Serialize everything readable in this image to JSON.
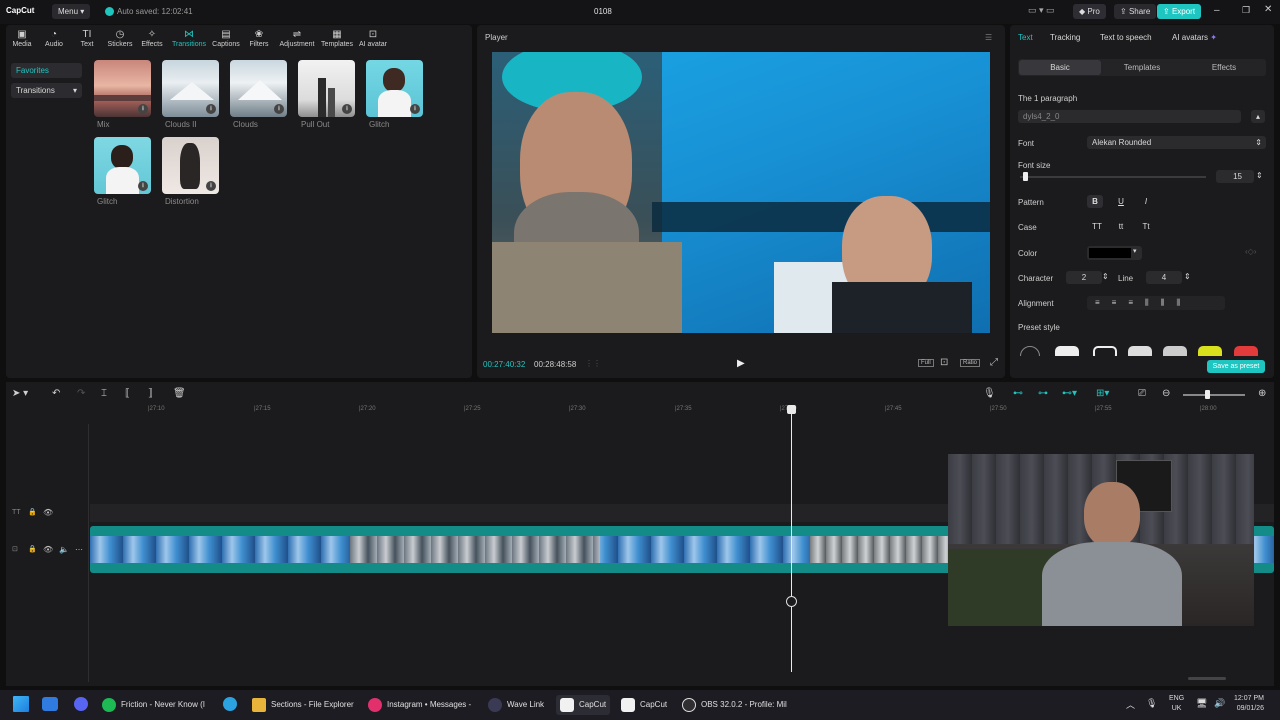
{
  "titlebar": {
    "logo": "CapCut",
    "menu": "Menu",
    "autosave": "Auto saved: 12:02:41",
    "project": "0108",
    "pro": "Pro",
    "share": "Share",
    "export": "Export"
  },
  "toolbar": {
    "items": [
      "Media",
      "Audio",
      "Text",
      "Stickers",
      "Effects",
      "Transitions",
      "Captions",
      "Filters",
      "Adjustment",
      "Templates",
      "AI avatar"
    ]
  },
  "sidebar": {
    "favorites": "Favorites",
    "transitions": "Transitions"
  },
  "transitions": [
    {
      "label": "Mix"
    },
    {
      "label": "Clouds II"
    },
    {
      "label": "Clouds"
    },
    {
      "label": "Pull Out"
    },
    {
      "label": "Glitch"
    },
    {
      "label": "Glitch"
    },
    {
      "label": "Distortion"
    }
  ],
  "player": {
    "title": "Player",
    "current": "00:27:40:32",
    "total": "00:28:48:58",
    "full": "Full",
    "ratio": "Ratio"
  },
  "props": {
    "tabs": [
      "Text",
      "Tracking",
      "Text to speech",
      "AI avatars"
    ],
    "subtabs": [
      "Basic",
      "Templates",
      "Effects"
    ],
    "paragraph": "The 1 paragraph",
    "text_value": "dyls4_2_0",
    "font_label": "Font",
    "font_value": "Alekan Rounded",
    "size_label": "Font size",
    "size_value": "15",
    "pattern_label": "Pattern",
    "case_label": "Case",
    "color_label": "Color",
    "character_label": "Character",
    "character_value": "2",
    "line_label": "Line",
    "line_value": "4",
    "alignment_label": "Alignment",
    "preset_label": "Preset style",
    "save_preset": "Save as preset",
    "bold": "B",
    "underline": "U",
    "italic": "I",
    "case_opts": [
      "TT",
      "tt",
      "Tt"
    ]
  },
  "timeline": {
    "ruler": [
      "|27:10",
      "|27:15",
      "|27:20",
      "|27:25",
      "|27:30",
      "|27:35",
      "|27:40",
      "|27:45",
      "|27:50",
      "|27:55",
      "|28:00"
    ],
    "text_track": "TT"
  },
  "taskbar": {
    "items": [
      "Friction - Never Know (I",
      "Sections - File Explorer",
      "Instagram • Messages -",
      "Wave Link",
      "CapCut",
      "CapCut",
      "OBS 32.0.2 - Profile: Mil"
    ],
    "lang": "ENG",
    "region": "UK",
    "time": "12:07 PM",
    "date": "09/01/26"
  }
}
